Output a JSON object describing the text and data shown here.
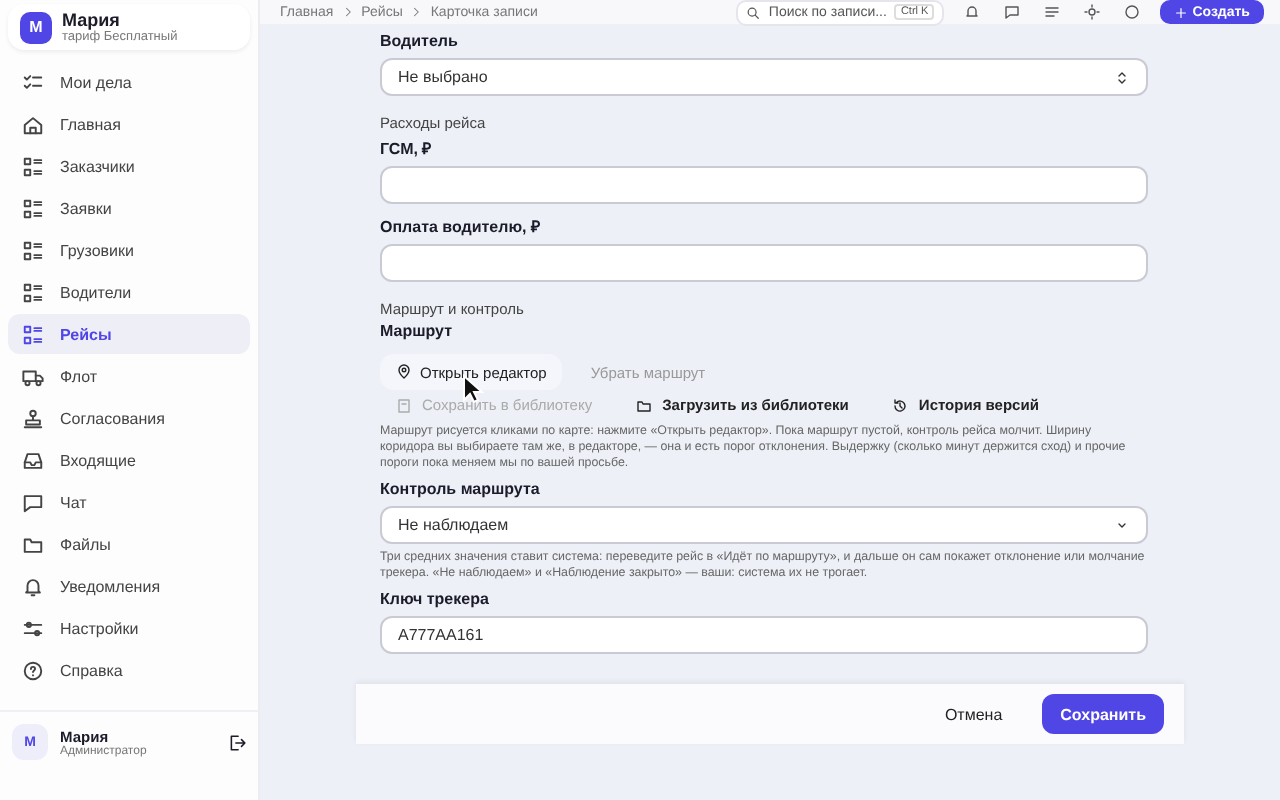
{
  "account": {
    "initial": "М",
    "name": "Мария",
    "plan": "тариф Бесплатный"
  },
  "breadcrumbs": [
    "Главная",
    "Рейсы",
    "Карточка записи"
  ],
  "search": {
    "placeholder": "Поиск по записи...",
    "shortcut": "Ctrl K"
  },
  "create_button": "Создать",
  "sidebar": {
    "items": [
      {
        "label": "Мои дела",
        "selected": false
      },
      {
        "label": "Главная",
        "selected": false
      },
      {
        "label": "Заказчики",
        "selected": false
      },
      {
        "label": "Заявки",
        "selected": false
      },
      {
        "label": "Грузовики",
        "selected": false
      },
      {
        "label": "Водители",
        "selected": false
      },
      {
        "label": "Рейсы",
        "selected": true
      },
      {
        "label": "Флот",
        "selected": false
      },
      {
        "label": "Согласования",
        "selected": false
      },
      {
        "label": "Входящие",
        "selected": false
      },
      {
        "label": "Чат",
        "selected": false
      },
      {
        "label": "Файлы",
        "selected": false
      },
      {
        "label": "Уведомления",
        "selected": false
      },
      {
        "label": "Настройки",
        "selected": false
      },
      {
        "label": "Справка",
        "selected": false
      }
    ]
  },
  "user": {
    "initial": "М",
    "name": "Мария",
    "role": "Администратор"
  },
  "form": {
    "driver": {
      "label": "Водитель",
      "value": "Не выбрано"
    },
    "expenses": {
      "section": "Расходы рейса",
      "fuel_label": "ГСМ, ₽",
      "driver_pay_label": "Оплата водителю, ₽"
    },
    "route": {
      "section": "Маршрут и контроль",
      "label": "Маршрут",
      "actions": [
        {
          "label": "Открыть редактор",
          "disabled": false,
          "primary": true
        },
        {
          "label": "Убрать маршрут",
          "disabled": true,
          "primary": false
        }
      ],
      "library_actions": [
        {
          "label": "Сохранить в библиотеку",
          "disabled": true
        },
        {
          "label": "Загрузить из библиотеки",
          "disabled": false
        },
        {
          "label": "История версий",
          "disabled": false
        }
      ],
      "help": "Маршрут рисуется кликами по карте: нажмите «Открыть редактор». Пока маршрут пустой, контроль рейса молчит. Ширину коридора вы выбираете там же, в редакторе, — она и есть порог отклонения. Выдержку (сколько минут держится сход) и прочие пороги пока меняем мы по вашей просьбе."
    },
    "route_control": {
      "label": "Контроль маршрута",
      "value": "Не наблюдаем",
      "help": "Три средних значения ставит система: переведите рейс в «Идёт по маршруту», и дальше он сам покажет отклонение или молчание трекера. «Не наблюдаем» и «Наблюдение закрыто» — ваши: система их не трогает."
    },
    "tracker": {
      "label": "Ключ трекера",
      "value": "А777АА161"
    }
  },
  "footer": {
    "cancel": "Отмена",
    "save": "Сохранить"
  }
}
